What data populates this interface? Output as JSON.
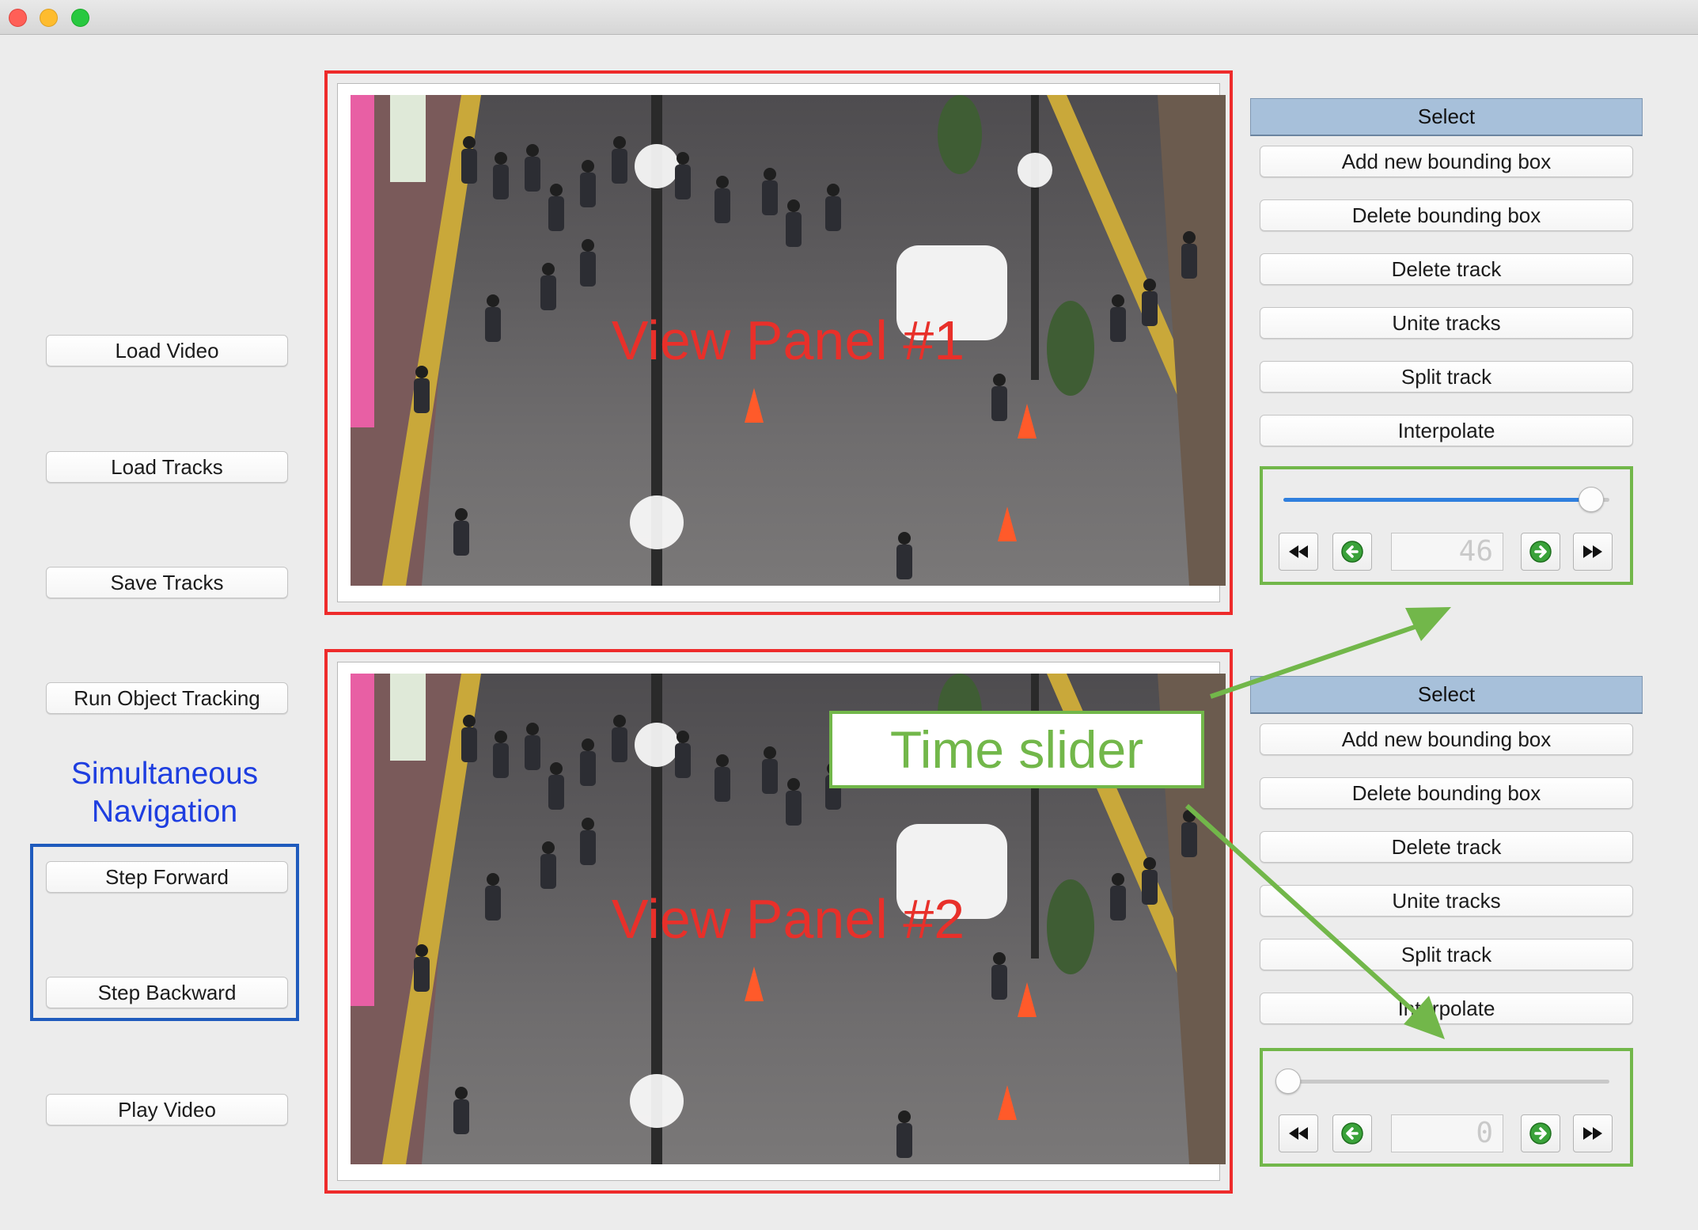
{
  "left": {
    "load_video": "Load Video",
    "load_tracks": "Load Tracks",
    "save_tracks": "Save Tracks",
    "run_tracking": "Run Object Tracking",
    "nav_caption_line1": "Simultaneous",
    "nav_caption_line2": "Navigation",
    "step_forward": "Step Forward",
    "step_backward": "Step Backward",
    "play_video": "Play Video"
  },
  "panels": [
    {
      "label": "View Panel #1",
      "controls": {
        "select": "Select",
        "add_box": "Add new bounding box",
        "delete_box": "Delete bounding box",
        "delete_track": "Delete track",
        "unite_tracks": "Unite tracks",
        "split_track": "Split track",
        "interpolate": "Interpolate"
      },
      "frame_display": "46",
      "slider_fraction": 0.93
    },
    {
      "label": "View Panel #2",
      "controls": {
        "select": "Select",
        "add_box": "Add new bounding box",
        "delete_box": "Delete bounding box",
        "delete_track": "Delete track",
        "unite_tracks": "Unite tracks",
        "split_track": "Split track",
        "interpolate": "Interpolate"
      },
      "frame_display": "0",
      "slider_fraction": 0.0
    }
  ],
  "annotation": {
    "time_slider_label": "Time slider"
  },
  "icons": {
    "skip_backward": "double-left-arrow-icon",
    "step_back": "green-left-circle-arrow-icon",
    "step_next": "green-right-circle-arrow-icon",
    "skip_forward": "double-right-arrow-icon"
  },
  "colors": {
    "panel_border": "#ee2b2b",
    "panel_label": "#e8302a",
    "slider_box_border": "#72b74a",
    "nav_box_border": "#1f5bbd",
    "nav_caption": "#1e3ee0",
    "select_header": "#a7c0da",
    "slider_fill": "#2f7fde"
  }
}
